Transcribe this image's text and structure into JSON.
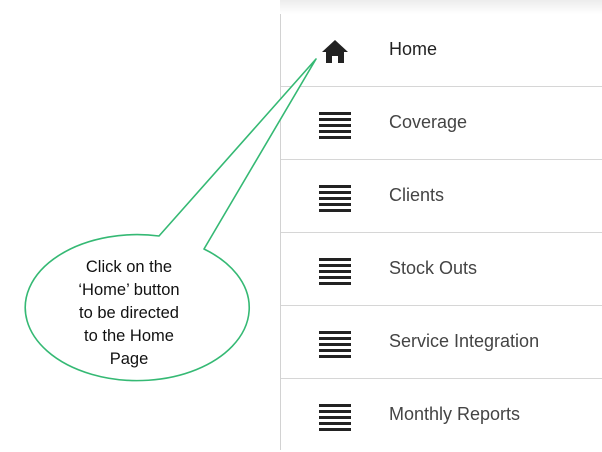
{
  "menu": {
    "items": [
      {
        "label": "Home",
        "icon": "home-icon"
      },
      {
        "label": "Coverage",
        "icon": "list-icon"
      },
      {
        "label": "Clients",
        "icon": "list-icon"
      },
      {
        "label": "Stock Outs",
        "icon": "list-icon"
      },
      {
        "label": "Service Integration",
        "icon": "list-icon"
      },
      {
        "label": "Monthly Reports",
        "icon": "list-icon"
      }
    ]
  },
  "callout": {
    "lines": [
      "Click on the",
      "‘Home’ button",
      "to be directed",
      "to the Home",
      "Page"
    ]
  },
  "colors": {
    "callout_border": "#35b974",
    "callout_fill": "#ffffff",
    "icon": "#222222",
    "divider": "#d6d6d6"
  }
}
